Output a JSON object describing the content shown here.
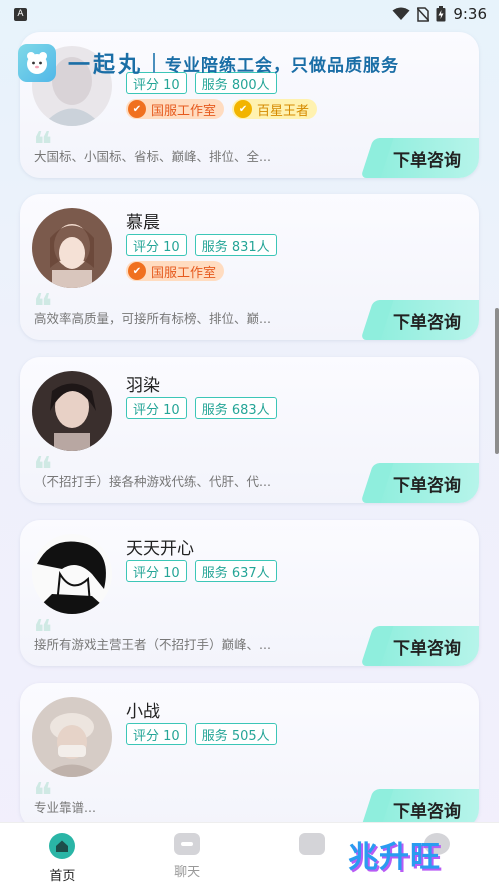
{
  "status_bar": {
    "left_badge": "A",
    "time": "9:36"
  },
  "header": {
    "app_name": "一起丸",
    "slogan": "专业陪练工会，只做品质服务"
  },
  "colors": {
    "accent": "#2ab5a6",
    "brand": "#1a6ea6",
    "tag_border": "#3cc6b7",
    "studio_badge": "#e65a1e",
    "king_badge": "#d58a00"
  },
  "players": [
    {
      "name": "",
      "rating": "评分 10",
      "service": "服务 800人",
      "badges": [
        "国服工作室",
        "百星王者"
      ],
      "desc": "大国标、小国标、省标、巅峰、排位、全...",
      "button": "下单咨询"
    },
    {
      "name": "慕晨",
      "rating": "评分 10",
      "service": "服务 831人",
      "badges": [
        "国服工作室"
      ],
      "desc": "高效率高质量，可接所有标榜、排位、巅...",
      "button": "下单咨询"
    },
    {
      "name": "羽染",
      "rating": "评分 10",
      "service": "服务 683人",
      "badges": [],
      "desc": "（不招打手）接各种游戏代练、代肝、代...",
      "button": "下单咨询"
    },
    {
      "name": "天天开心",
      "rating": "评分 10",
      "service": "服务 637人",
      "badges": [],
      "desc": "接所有游戏主营王者（不招打手）巅峰、...",
      "button": "下单咨询"
    },
    {
      "name": "小战",
      "rating": "评分 10",
      "service": "服务 505人",
      "badges": [],
      "desc": "专业靠谱...",
      "button": "下单咨询"
    }
  ],
  "tabbar": {
    "home": "首页",
    "chat": "聊天"
  },
  "watermark": "兆升旺",
  "icons": {
    "quote": "❝",
    "studio": "medal-icon",
    "king": "check-badge-icon"
  }
}
